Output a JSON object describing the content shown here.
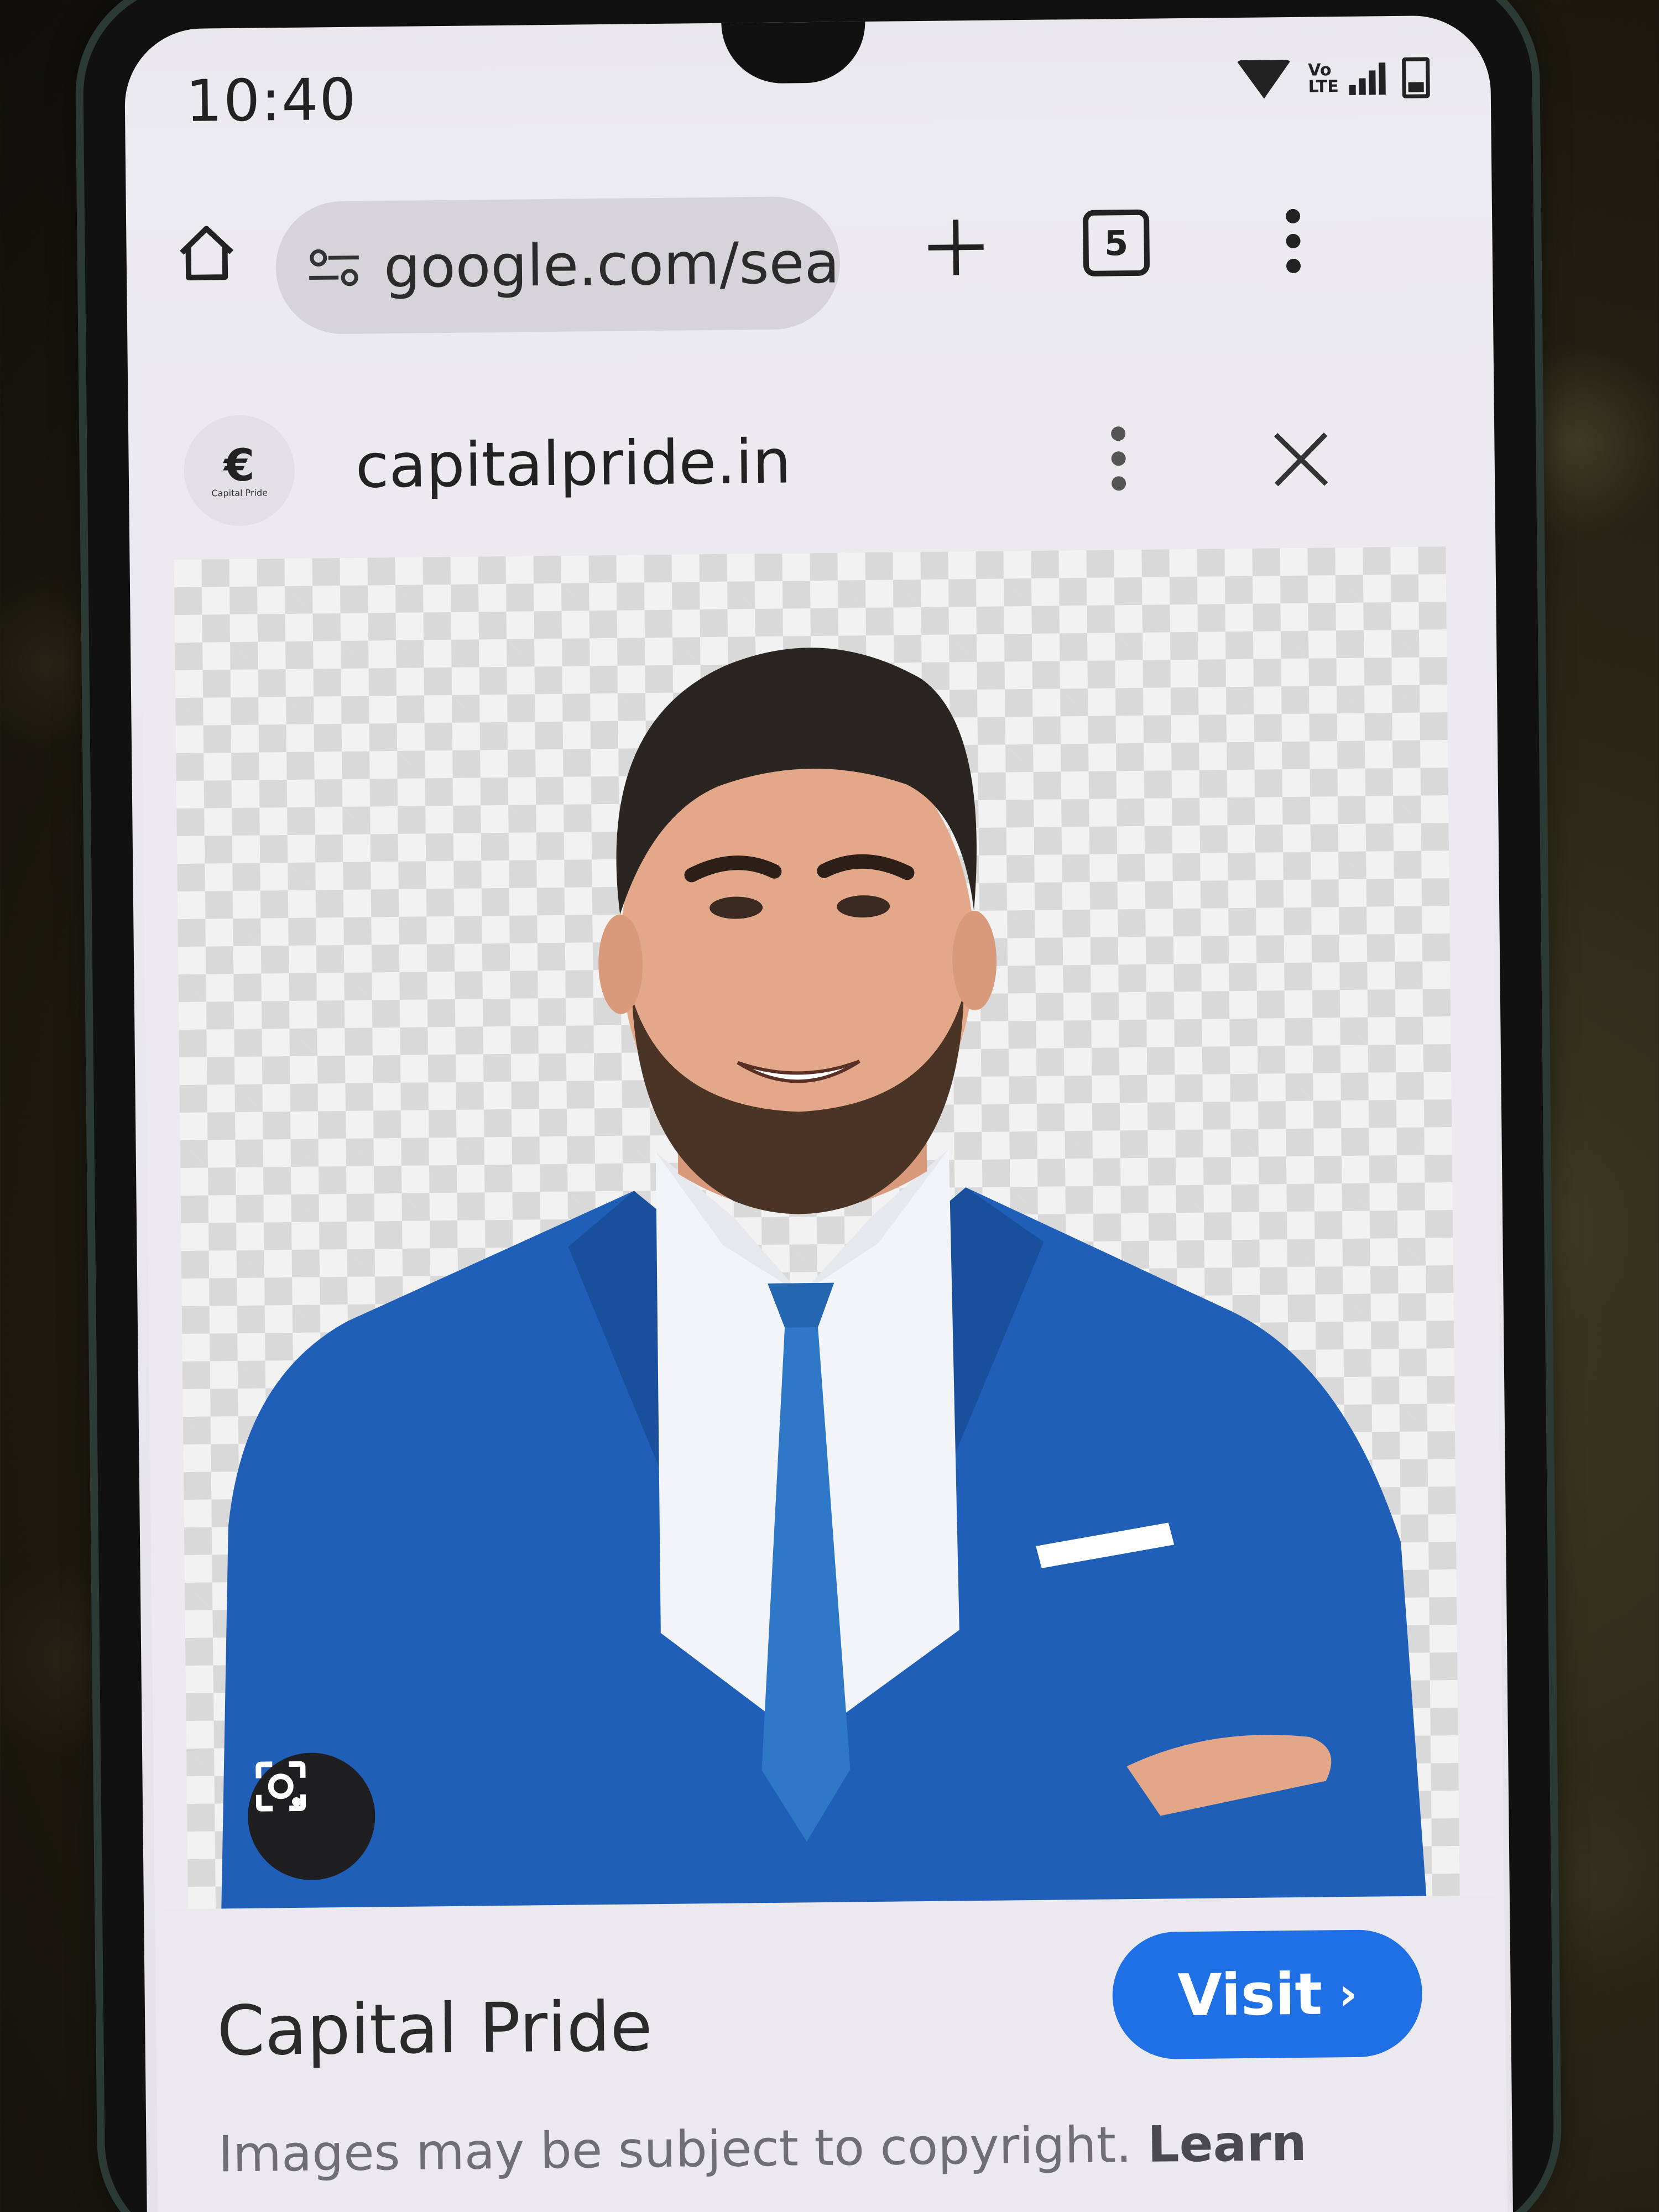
{
  "status_bar": {
    "time": "10:40",
    "network_label": "Vo LTE"
  },
  "toolbar": {
    "url": "google.com/sea",
    "tab_count": "5"
  },
  "viewer": {
    "site_domain": "capitalpride.in",
    "favicon_caption": "Capital Pride",
    "image_subject": "man in blue suit and tie smiling, transparent checkered background",
    "title": "Capital Pride",
    "visit_label": "Visit",
    "copyright_text": "Images may be subject to copyright. ",
    "learn_more_label": "Learn more"
  },
  "colors": {
    "visit_button": "#1f6fe5",
    "suit": "#1f5fb8",
    "tie": "#2f78c8"
  }
}
